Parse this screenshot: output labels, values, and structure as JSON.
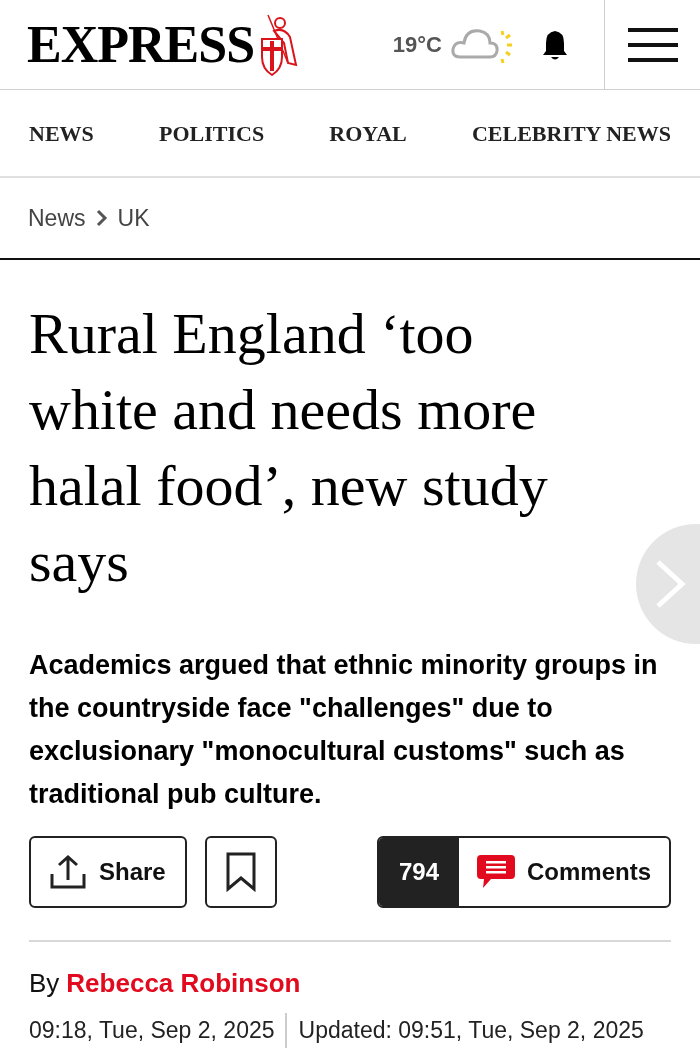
{
  "header": {
    "logo": "EXPRESS",
    "temperature": "19°C"
  },
  "nav": {
    "items": [
      "NEWS",
      "POLITICS",
      "ROYAL",
      "CELEBRITY NEWS"
    ]
  },
  "breadcrumb": [
    "News",
    "UK"
  ],
  "article": {
    "headline": "Rural England ‘too white and needs more halal food’, new study says",
    "standfirst": "Academics argued that ethnic minority groups in the countryside face \"challenges\" due to exclusionary \"monocultural customs\" such as traditional pub culture.",
    "share_label": "Share",
    "comment_count": "794",
    "comments_label": "Comments",
    "byline_prefix": "By",
    "author": "Rebecca Robinson",
    "published": "09:18, Tue, Sep 2, 2025",
    "updated": "Updated: 09:51, Tue, Sep 2, 2025"
  }
}
